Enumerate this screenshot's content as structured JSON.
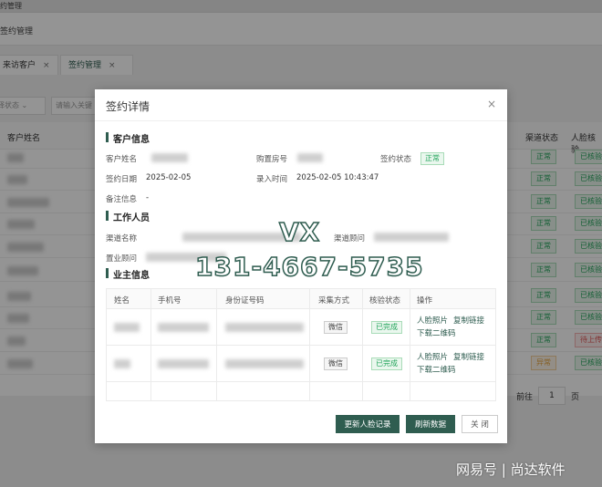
{
  "app": {
    "top_title": "约管理",
    "breadcrumb": "签约管理",
    "tabs": [
      {
        "label": "来访客户",
        "close": "×"
      },
      {
        "label": "签约管理",
        "close": "×"
      }
    ],
    "filters": {
      "status_placeholder": "择状态",
      "keyword_placeholder": "请输入关键"
    },
    "columns": {
      "customer_name": "客户姓名",
      "channel_status": "渠道状态",
      "face_check": "人脸核验"
    },
    "rows": [
      {
        "channel": "正常",
        "face": "已核验"
      },
      {
        "channel": "正常",
        "face": "已核验"
      },
      {
        "channel": "正常",
        "face": "已核验"
      },
      {
        "channel": "正常",
        "face": "已核验"
      },
      {
        "channel": "正常",
        "face": "已核验"
      },
      {
        "channel": "正常",
        "face": "已核验"
      },
      {
        "channel": "正常",
        "face": "已核验"
      },
      {
        "channel": "正常",
        "face": "已核验"
      },
      {
        "channel": "正常",
        "face": "待上传"
      },
      {
        "channel": "异常",
        "face": "已核验"
      }
    ],
    "pager": {
      "goto": "前往",
      "page": "1",
      "unit": "页"
    }
  },
  "modal": {
    "title": "签约详情",
    "close": "×",
    "sections": {
      "customer": "客户信息",
      "staff": "工作人员",
      "owner": "业主信息"
    },
    "customer": {
      "name_label": "客户姓名",
      "room_label": "购置房号",
      "sign_status_label": "签约状态",
      "sign_status": "正常",
      "sign_date_label": "签约日期",
      "sign_date": "2025-02-05",
      "entry_time_label": "录入时间",
      "entry_time": "2025-02-05 10:43:47",
      "remark_label": "备注信息",
      "remark": "-"
    },
    "staff": {
      "channel_name_label": "渠道名称",
      "channel_consultant_label": "渠道顾问",
      "property_consultant_label": "置业顾问"
    },
    "owner_table": {
      "headers": [
        "姓名",
        "手机号",
        "身份证号码",
        "采集方式",
        "核验状态",
        "操作"
      ],
      "rows": [
        {
          "method": "微信",
          "status": "已完成",
          "op_photo": "人脸照片",
          "op_copy": "复制链接",
          "op_qr": "下载二维码"
        },
        {
          "method": "微信",
          "status": "已完成",
          "op_photo": "人脸照片",
          "op_copy": "复制链接",
          "op_qr": "下载二维码"
        }
      ]
    },
    "buttons": {
      "update_face": "更新人脸记录",
      "refresh": "刷新数据",
      "close": "关 闭"
    }
  },
  "watermark": {
    "vx": "VX",
    "phone": "131-4667-5735",
    "footer": "网易号 | 尚达软件"
  },
  "colors": {
    "accent": "#2f5d50",
    "success": "#22a45a",
    "warning": "#e6a23c",
    "danger": "#e05555"
  }
}
